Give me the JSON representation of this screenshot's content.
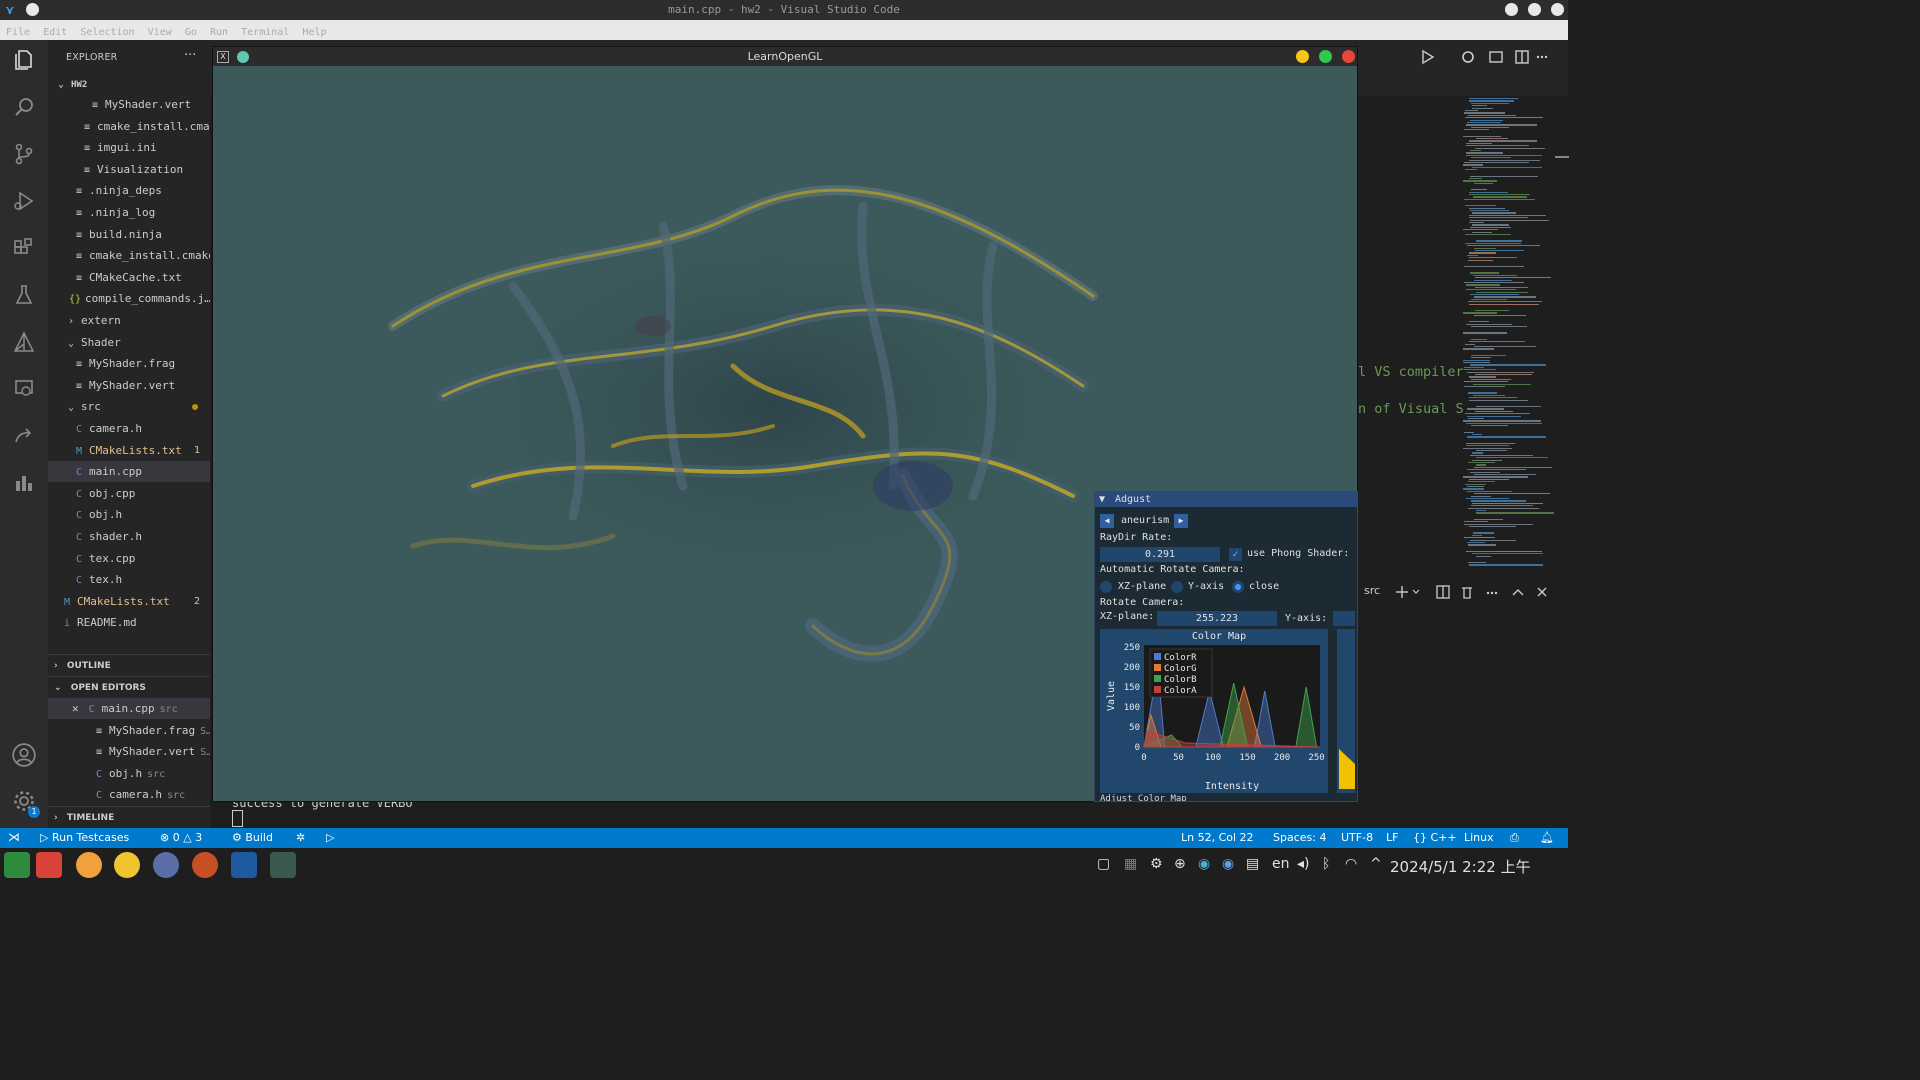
{
  "window": {
    "title": "main.cpp - hw2 - Visual Studio Code"
  },
  "menu": [
    "File",
    "Edit",
    "Selection",
    "View",
    "Go",
    "Run",
    "Terminal",
    "Help"
  ],
  "explorer": {
    "header": "EXPLORER",
    "more": "···",
    "folder": "HW2",
    "items": [
      {
        "label": "MyShader.vert",
        "icon": "≡"
      },
      {
        "label": "cmake_install.cma…",
        "icon": "≡"
      },
      {
        "label": "imgui.ini",
        "icon": "≡"
      },
      {
        "label": "Visualization",
        "icon": "≡"
      },
      {
        "label": ".ninja_deps",
        "icon": "≡"
      },
      {
        "label": ".ninja_log",
        "icon": "≡"
      },
      {
        "label": "build.ninja",
        "icon": "≡"
      },
      {
        "label": "cmake_install.cmake",
        "icon": "≡"
      },
      {
        "label": "CMakeCache.txt",
        "icon": "≡"
      },
      {
        "label": "compile_commands.j…",
        "icon": "{}"
      },
      {
        "label": "extern",
        "icon": ">"
      },
      {
        "label": "Shader",
        "icon": "v"
      },
      {
        "label": "MyShader.frag",
        "icon": "≡"
      },
      {
        "label": "MyShader.vert",
        "icon": "≡"
      },
      {
        "label": "src",
        "icon": "v"
      },
      {
        "label": "camera.h",
        "icon": "C"
      },
      {
        "label": "CMakeLists.txt",
        "icon": "M",
        "badge": "1"
      },
      {
        "label": "main.cpp",
        "icon": "G"
      },
      {
        "label": "obj.cpp",
        "icon": "G"
      },
      {
        "label": "obj.h",
        "icon": "C"
      },
      {
        "label": "shader.h",
        "icon": "C"
      },
      {
        "label": "tex.cpp",
        "icon": "G"
      },
      {
        "label": "tex.h",
        "icon": "C"
      },
      {
        "label": "CMakeLists.txt",
        "icon": "M",
        "badge": "2"
      },
      {
        "label": "README.md",
        "icon": "i"
      }
    ],
    "outline": "OUTLINE",
    "open_editors": "OPEN EDITORS",
    "open_items": [
      {
        "name": "main.cpp",
        "path": "src"
      },
      {
        "name": "MyShader.frag",
        "path": "S…"
      },
      {
        "name": "MyShader.vert",
        "path": "S…"
      },
      {
        "name": "obj.h",
        "path": "src"
      },
      {
        "name": "camera.h",
        "path": "src"
      }
    ],
    "timeline": "TIMELINE"
  },
  "editor": {
    "fragments": [
      "l VS compiler",
      "n of Visual S"
    ],
    "terminal_text": "success to generate VERBO",
    "terminal_label": "src"
  },
  "gl_window": {
    "title": "LearnOpenGL"
  },
  "imgui": {
    "title": "Adgust",
    "dataset": "aneurism",
    "raydir_label": "RayDir Rate:",
    "raydir_value": "0.291",
    "phong_label": "use Phong Shader:",
    "auto_rotate_label": "Automatic Rotate Camera:",
    "radio_xz": "XZ-plane",
    "radio_y": "Y-axis",
    "radio_close": "close",
    "rotate_label": "Rotate Camera:",
    "xz_label": "XZ-plane:",
    "xz_value": "255.223",
    "y_label": "Y-axis:",
    "footer_label": "Adjust Color Map"
  },
  "chart_data": {
    "type": "area",
    "title": "Color Map",
    "xlabel": "Intensity",
    "ylabel": "Value",
    "xlim": [
      0,
      255
    ],
    "ylim": [
      0,
      255
    ],
    "xticks": [
      0,
      50,
      100,
      150,
      200,
      250
    ],
    "yticks": [
      0,
      50,
      100,
      150,
      200,
      250
    ],
    "legend_position": "top-left",
    "series": [
      {
        "name": "ColorR",
        "color": "#4c7bd0",
        "points": [
          [
            0,
            0
          ],
          [
            20,
            200
          ],
          [
            30,
            0
          ],
          [
            75,
            0
          ],
          [
            95,
            140
          ],
          [
            115,
            0
          ],
          [
            160,
            0
          ],
          [
            175,
            140
          ],
          [
            190,
            0
          ],
          [
            255,
            0
          ]
        ]
      },
      {
        "name": "ColorG",
        "color": "#e07b39",
        "points": [
          [
            0,
            0
          ],
          [
            10,
            80
          ],
          [
            25,
            0
          ],
          [
            120,
            0
          ],
          [
            145,
            150
          ],
          [
            170,
            0
          ],
          [
            255,
            0
          ]
        ]
      },
      {
        "name": "ColorB",
        "color": "#3fa34d",
        "points": [
          [
            0,
            0
          ],
          [
            40,
            30
          ],
          [
            55,
            0
          ],
          [
            110,
            0
          ],
          [
            130,
            160
          ],
          [
            150,
            0
          ],
          [
            220,
            0
          ],
          [
            235,
            150
          ],
          [
            250,
            0
          ],
          [
            255,
            0
          ]
        ]
      },
      {
        "name": "ColorA",
        "color": "#c04040",
        "points": [
          [
            0,
            0
          ],
          [
            5,
            40
          ],
          [
            60,
            10
          ],
          [
            160,
            5
          ],
          [
            255,
            0
          ]
        ]
      }
    ]
  },
  "statusbar": {
    "run_testcases": "Run Testcases",
    "errors": "0",
    "warnings": "3",
    "build": "Build",
    "position": "Ln 52, Col 22",
    "spaces": "Spaces: 4",
    "encoding": "UTF-8",
    "eol": "LF",
    "language": "{} C++",
    "os": "Linux"
  },
  "taskbar": {
    "lang": "en",
    "datetime": "2024/5/1  2:22 上午"
  }
}
